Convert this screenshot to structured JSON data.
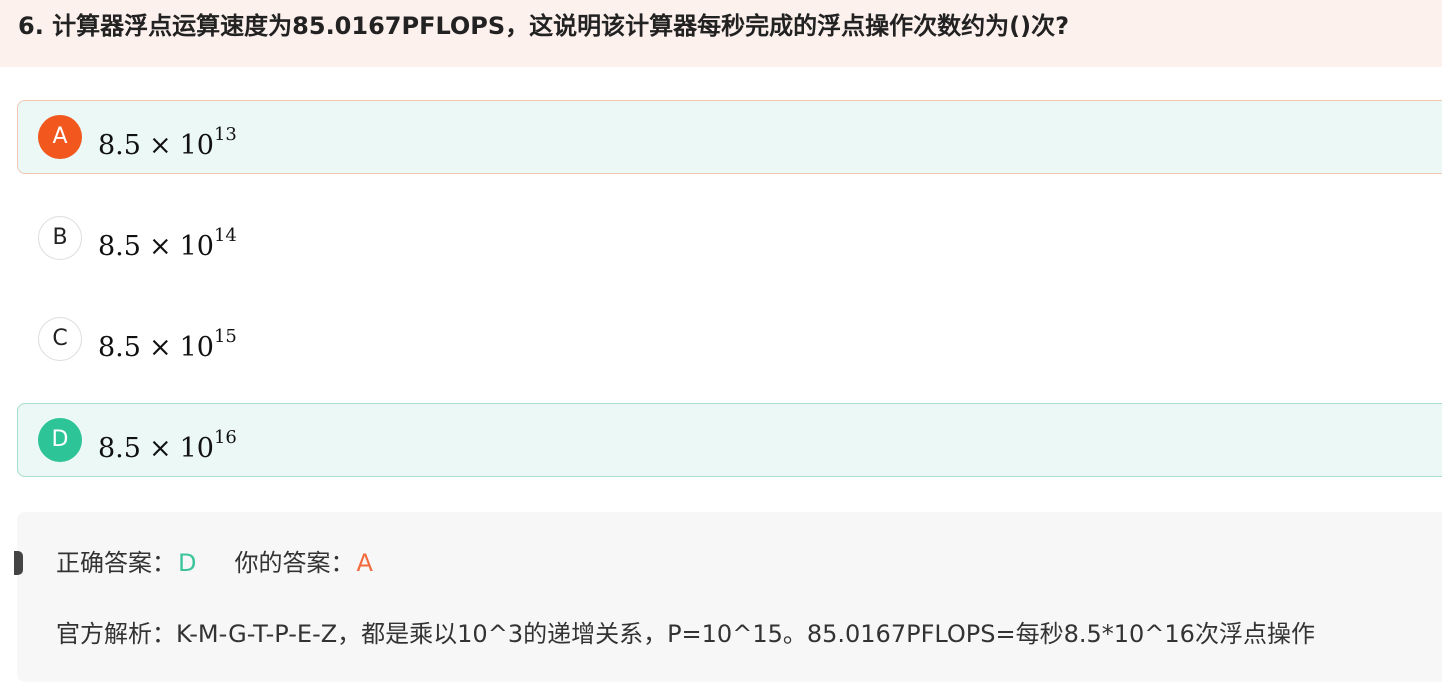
{
  "question": {
    "title": "6. 计算器浮点运算速度为85.0167PFLOPS，这说明该计算器每秒完成的浮点操作次数约为()次?"
  },
  "options": [
    {
      "letter": "A",
      "base": "8.5",
      "times": "×",
      "pow_base": "10",
      "exponent": "13",
      "state": "your-wrong"
    },
    {
      "letter": "B",
      "base": "8.5",
      "times": "×",
      "pow_base": "10",
      "exponent": "14",
      "state": "none"
    },
    {
      "letter": "C",
      "base": "8.5",
      "times": "×",
      "pow_base": "10",
      "exponent": "15",
      "state": "none"
    },
    {
      "letter": "D",
      "base": "8.5",
      "times": "×",
      "pow_base": "10",
      "exponent": "16",
      "state": "correct"
    }
  ],
  "answer": {
    "correct_label": "正确答案：",
    "correct_value": "D",
    "yours_label": "你的答案：",
    "yours_value": "A"
  },
  "explanation": {
    "text": "官方解析：K-M-G-T-P-E-Z，都是乘以10^3的递增关系，P=10^15。85.0167PFLOPS=每秒8.5*10^16次浮点操作"
  },
  "colors": {
    "wrong": "#f2581e",
    "correct": "#2dc497",
    "header_bg": "#fdf1ee",
    "option_bg": "#ebf8f5"
  }
}
